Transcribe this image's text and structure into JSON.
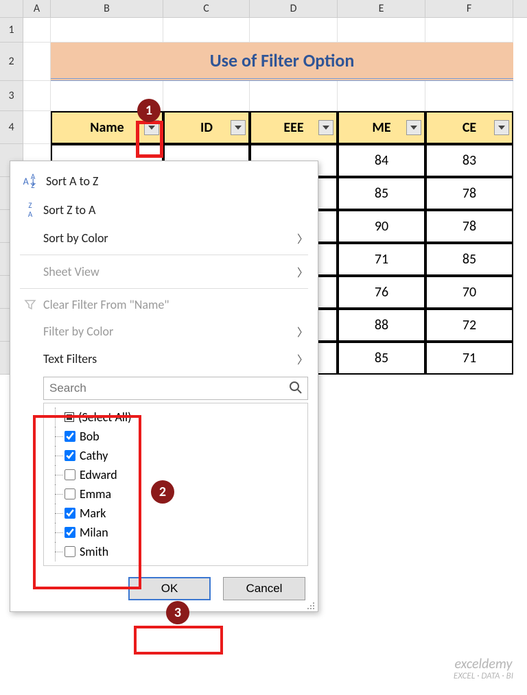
{
  "columns": [
    "A",
    "B",
    "C",
    "D",
    "E",
    "F"
  ],
  "row_nums": [
    "1",
    "2",
    "3",
    "4"
  ],
  "title": "Use of Filter Option",
  "headers": {
    "name": "Name",
    "id": "ID",
    "eee": "EEE",
    "me": "ME",
    "ce": "CE"
  },
  "data_rows": [
    {
      "me": "84",
      "ce": "83"
    },
    {
      "me": "85",
      "ce": "78"
    },
    {
      "me": "90",
      "ce": "78"
    },
    {
      "me": "71",
      "ce": "85"
    },
    {
      "me": "76",
      "ce": "70"
    },
    {
      "me": "88",
      "ce": "72"
    },
    {
      "me": "85",
      "ce": "71"
    }
  ],
  "menu": {
    "sort_az": "Sort A to Z",
    "sort_za": "Sort Z to A",
    "sort_color": "Sort by Color",
    "sheet_view": "Sheet View",
    "clear_filter": "Clear Filter From \"Name\"",
    "filter_color": "Filter by Color",
    "text_filters": "Text Filters",
    "search_placeholder": "Search",
    "select_all": "(Select All)",
    "items": [
      {
        "label": "Bob",
        "checked": true
      },
      {
        "label": "Cathy",
        "checked": true
      },
      {
        "label": "Edward",
        "checked": false
      },
      {
        "label": "Emma",
        "checked": false
      },
      {
        "label": "Mark",
        "checked": true
      },
      {
        "label": "Milan",
        "checked": true
      },
      {
        "label": "Smith",
        "checked": false
      }
    ],
    "ok": "OK",
    "cancel": "Cancel"
  },
  "callouts": {
    "c1": "1",
    "c2": "2",
    "c3": "3"
  },
  "watermark": {
    "brand": "exceldemy",
    "tag": "EXCEL · DATA · BI"
  },
  "chart_data": {
    "type": "table",
    "title": "Use of Filter Option",
    "columns": [
      "Name",
      "ID",
      "EEE",
      "ME",
      "CE"
    ],
    "visible_values": {
      "ME": [
        84,
        85,
        90,
        71,
        76,
        88,
        85
      ],
      "CE": [
        83,
        78,
        78,
        85,
        70,
        72,
        71
      ]
    },
    "filter_column": "Name",
    "filter_options": [
      "Bob",
      "Cathy",
      "Edward",
      "Emma",
      "Mark",
      "Milan",
      "Smith"
    ],
    "filter_selected": [
      "Bob",
      "Cathy",
      "Mark",
      "Milan"
    ]
  }
}
